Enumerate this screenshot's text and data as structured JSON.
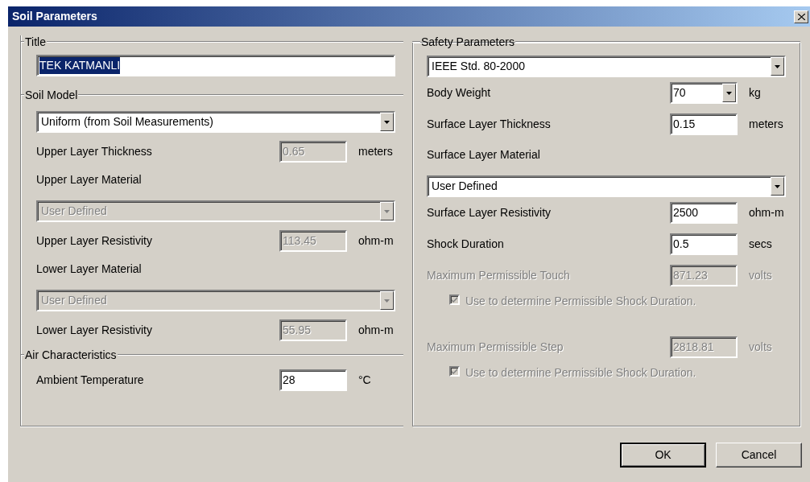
{
  "window": {
    "title": "Soil Parameters"
  },
  "left_panel": {
    "groups": [
      {
        "legend": "Title",
        "rows": [
          {
            "kind": "text",
            "value": "TEK KATMANLI",
            "selected": true
          }
        ]
      },
      {
        "legend": "Soil Model",
        "rows": [
          {
            "kind": "dropdown",
            "value": "Uniform (from Soil Measurements)",
            "disabled": false
          },
          {
            "kind": "number",
            "label": "Upper Layer Thickness",
            "value": "0.65",
            "unit": "meters",
            "disabled": true,
            "label_disabled": false
          },
          {
            "kind": "label",
            "label": "Upper Layer Material",
            "label_disabled": false
          },
          {
            "kind": "dropdown",
            "value": "User Defined",
            "disabled": true
          },
          {
            "kind": "number",
            "label": "Upper Layer Resistivity",
            "value": "113.45",
            "unit": "ohm-m",
            "disabled": true,
            "label_disabled": false
          },
          {
            "kind": "label",
            "label": "Lower Layer Material",
            "label_disabled": false
          },
          {
            "kind": "dropdown",
            "value": "User Defined",
            "disabled": true
          },
          {
            "kind": "number",
            "label": "Lower Layer Resistivity",
            "value": "55.95",
            "unit": "ohm-m",
            "disabled": true,
            "label_disabled": false
          }
        ]
      },
      {
        "legend": "Air Characteristics",
        "rows": [
          {
            "kind": "number",
            "label": "Ambient Temperature",
            "value": "28",
            "unit": "°C",
            "disabled": false,
            "label_disabled": false
          }
        ]
      }
    ]
  },
  "right_panel": {
    "legend": "Safety Parameters",
    "rows": [
      {
        "kind": "dropdown",
        "value": "IEEE Std. 80-2000",
        "disabled": false
      },
      {
        "kind": "combo",
        "label": "Body Weight",
        "value": "70",
        "unit": "kg",
        "disabled": false,
        "label_disabled": false
      },
      {
        "kind": "number",
        "label": "Surface Layer Thickness",
        "value": "0.15",
        "unit": "meters",
        "disabled": false,
        "label_disabled": false
      },
      {
        "kind": "label",
        "label": "Surface Layer Material",
        "label_disabled": false
      },
      {
        "kind": "dropdown",
        "value": "User Defined",
        "disabled": false
      },
      {
        "kind": "number",
        "label": "Surface Layer Resistivity",
        "value": "2500",
        "unit": "ohm-m",
        "disabled": false,
        "label_disabled": false
      },
      {
        "kind": "number",
        "label": "Shock Duration",
        "value": "0.5",
        "unit": "secs",
        "disabled": false,
        "label_disabled": false
      },
      {
        "kind": "number",
        "label": "Maximum Permissible Touch",
        "value": "871.23",
        "unit": "volts",
        "disabled": true,
        "label_disabled": true
      },
      {
        "kind": "checkbox",
        "label": "Use to determine Permissible Shock Duration.",
        "checked": true,
        "disabled": true
      },
      {
        "kind": "number",
        "label": "Maximum Permissible Step",
        "value": "2818.81",
        "unit": "volts",
        "disabled": true,
        "label_disabled": true
      },
      {
        "kind": "checkbox",
        "label": "Use to determine Permissible Shock Duration.",
        "checked": true,
        "disabled": true
      }
    ]
  },
  "buttons": [
    {
      "label": "OK",
      "default": true
    },
    {
      "label": "Cancel",
      "default": false
    }
  ]
}
